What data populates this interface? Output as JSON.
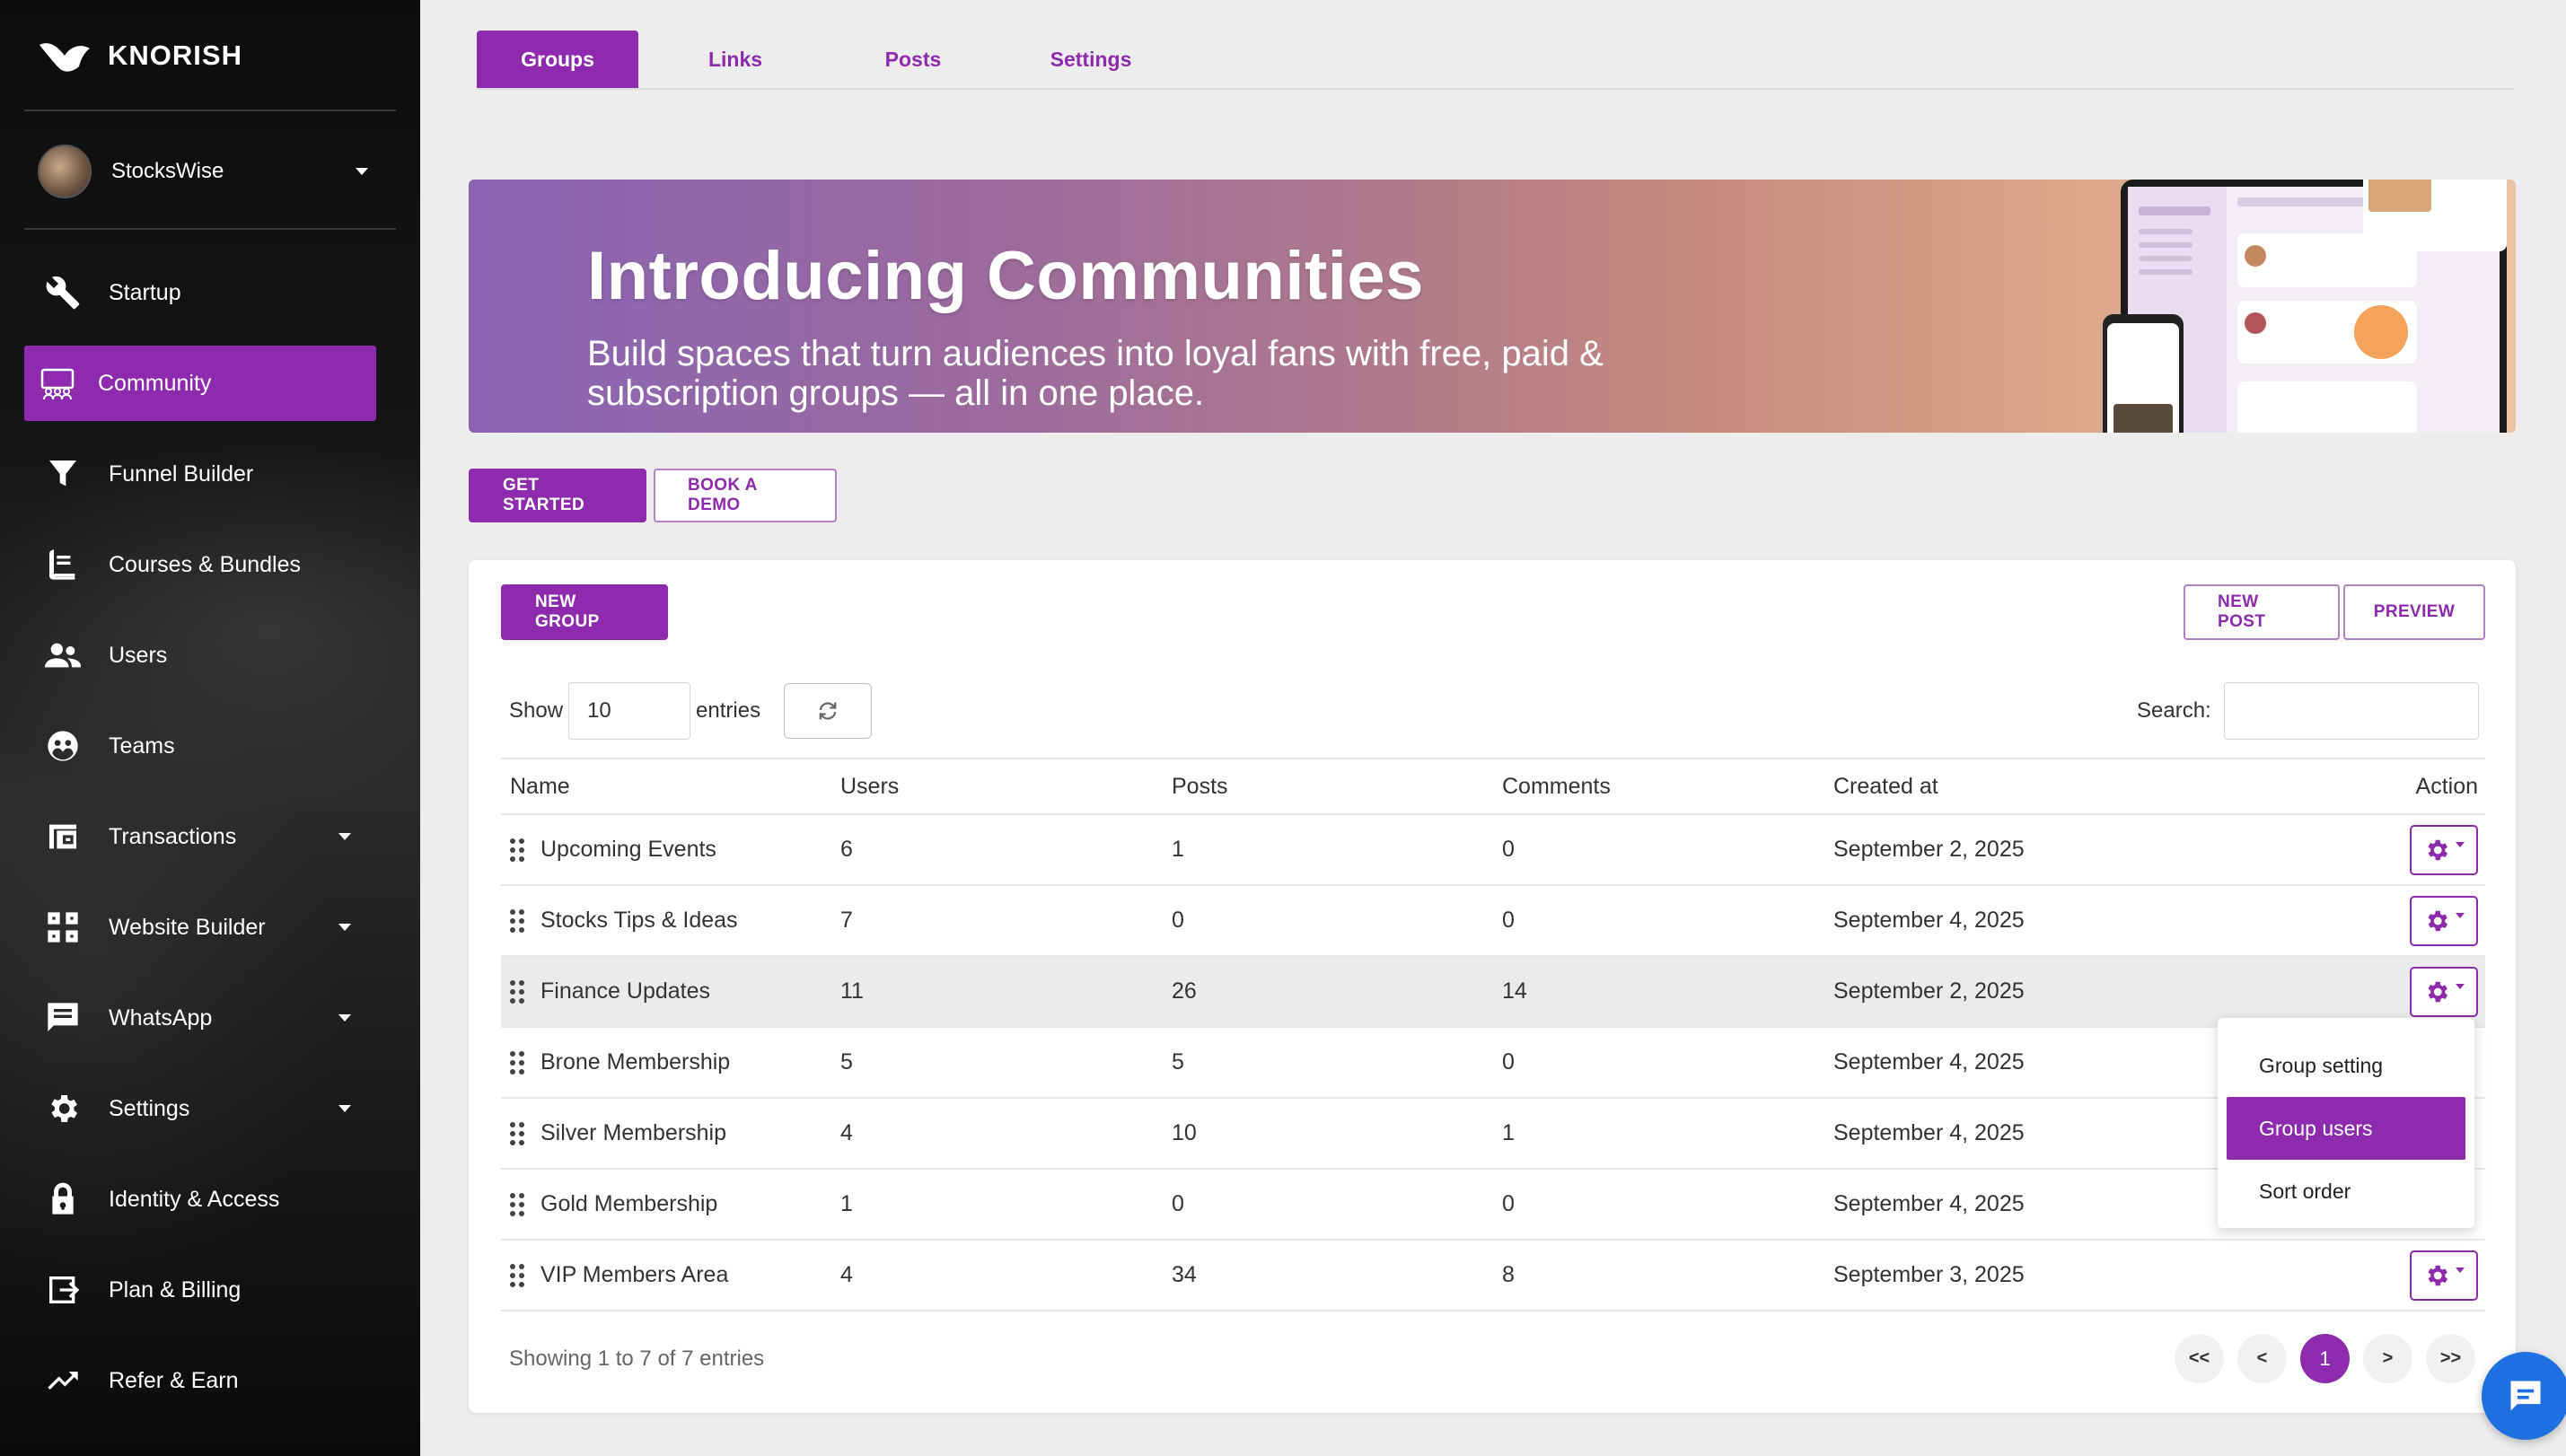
{
  "brand": {
    "name": "KNORISH"
  },
  "account": {
    "name": "StocksWise"
  },
  "sidebar": {
    "items": [
      {
        "label": "Startup",
        "icon": "wrench-icon",
        "active": false,
        "has_caret": false
      },
      {
        "label": "Community",
        "icon": "community-icon",
        "active": true,
        "has_caret": false
      },
      {
        "label": "Funnel Builder",
        "icon": "funnel-icon",
        "active": false,
        "has_caret": false
      },
      {
        "label": "Courses & Bundles",
        "icon": "book-icon",
        "active": false,
        "has_caret": false
      },
      {
        "label": "Users",
        "icon": "users-icon",
        "active": false,
        "has_caret": false
      },
      {
        "label": "Teams",
        "icon": "teams-icon",
        "active": false,
        "has_caret": false
      },
      {
        "label": "Transactions",
        "icon": "wallet-icon",
        "active": false,
        "has_caret": true
      },
      {
        "label": "Website Builder",
        "icon": "website-icon",
        "active": false,
        "has_caret": true
      },
      {
        "label": "WhatsApp",
        "icon": "message-icon",
        "active": false,
        "has_caret": true
      },
      {
        "label": "Settings",
        "icon": "gear-icon",
        "active": false,
        "has_caret": true
      },
      {
        "label": "Identity & Access",
        "icon": "lock-icon",
        "active": false,
        "has_caret": false
      },
      {
        "label": "Plan & Billing",
        "icon": "billing-icon",
        "active": false,
        "has_caret": false
      },
      {
        "label": "Refer & Earn",
        "icon": "trend-icon",
        "active": false,
        "has_caret": false
      }
    ]
  },
  "tabs": [
    {
      "label": "Groups",
      "active": true
    },
    {
      "label": "Links",
      "active": false
    },
    {
      "label": "Posts",
      "active": false
    },
    {
      "label": "Settings",
      "active": false
    }
  ],
  "banner": {
    "title": "Introducing Communities",
    "subtitle": "Build spaces that turn audiences into loyal fans with free, paid & subscription groups — all in one place."
  },
  "cta": {
    "get_started": "GET STARTED",
    "book_demo": "BOOK A DEMO"
  },
  "toolbar": {
    "new_group": "NEW GROUP",
    "new_post": "NEW POST",
    "preview": "PREVIEW"
  },
  "table_controls": {
    "show_label": "Show",
    "page_size": "10",
    "entries_label": "entries",
    "search_label": "Search:",
    "search_value": ""
  },
  "table": {
    "columns": [
      "Name",
      "Users",
      "Posts",
      "Comments",
      "Created at",
      "Action"
    ],
    "rows": [
      {
        "name": "Upcoming Events",
        "users": "6",
        "posts": "1",
        "comments": "0",
        "created": "September 2, 2025"
      },
      {
        "name": "Stocks Tips & Ideas",
        "users": "7",
        "posts": "0",
        "comments": "0",
        "created": "September 4, 2025"
      },
      {
        "name": "Finance Updates",
        "users": "11",
        "posts": "26",
        "comments": "14",
        "created": "September 2, 2025"
      },
      {
        "name": "Brone Membership",
        "users": "5",
        "posts": "5",
        "comments": "0",
        "created": "September 4, 2025"
      },
      {
        "name": "Silver Membership",
        "users": "4",
        "posts": "10",
        "comments": "1",
        "created": "September 4, 2025"
      },
      {
        "name": "Gold Membership",
        "users": "1",
        "posts": "0",
        "comments": "0",
        "created": "September 4, 2025"
      },
      {
        "name": "VIP Members Area",
        "users": "4",
        "posts": "34",
        "comments": "8",
        "created": "September 3, 2025"
      }
    ]
  },
  "action_menu": {
    "items": [
      {
        "label": "Group setting",
        "active": false
      },
      {
        "label": "Group users",
        "active": true
      },
      {
        "label": "Sort order",
        "active": false
      }
    ]
  },
  "footer": {
    "info": "Showing 1 to 7 of 7 entries"
  },
  "pagination": {
    "first": "<<",
    "prev": "<",
    "current": "1",
    "next": ">",
    "last": ">>"
  },
  "colors": {
    "accent": "#8e2aad",
    "chat": "#1e6fe0"
  }
}
